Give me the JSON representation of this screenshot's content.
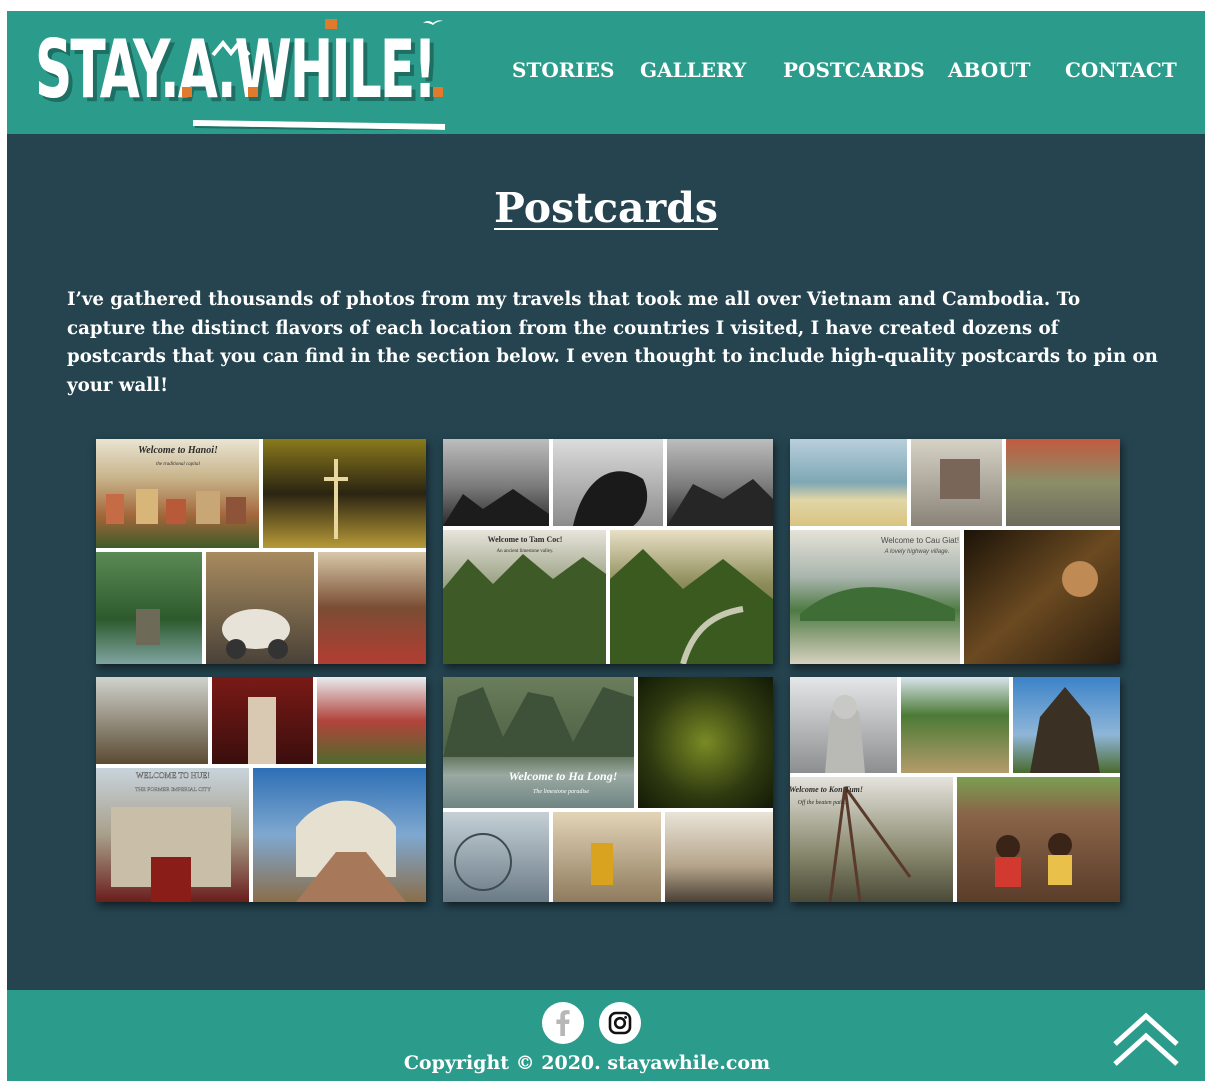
{
  "header": {
    "logo_text": "STAY.A.WHILE!",
    "nav": [
      {
        "label": "STORIES"
      },
      {
        "label": "GALLERY"
      },
      {
        "label": "POSTCARDS"
      },
      {
        "label": "ABOUT"
      },
      {
        "label": "CONTACT"
      }
    ]
  },
  "main": {
    "title": "Postcards",
    "intro": "I’ve gathered thousands of photos from my travels that took me all over Vietnam and Cambodia. To capture the distinct flavors of each location from the countries I visited, I have created dozens of postcards that you can find in the section below. I even thought to include high-quality postcards to pin on your wall!",
    "postcards": [
      {
        "caption_title": "Welcome to Hanoi!",
        "caption_sub": "the traditional capital"
      },
      {
        "caption_title": "Welcome to Tam Coc!",
        "caption_sub": "An ancient limestone valley."
      },
      {
        "caption_title": "Welcome to Cau Giat!",
        "caption_sub": "A lovely highway village."
      },
      {
        "caption_title": "WELCOME TO HUE!",
        "caption_sub": "THE FORMER IMPERIAL CITY"
      },
      {
        "caption_title": "Welcome to Ha Long!",
        "caption_sub": "The limestone paradise"
      },
      {
        "caption_title": "Welcome to Kon Tum!",
        "caption_sub": "Off the beaten path..."
      }
    ]
  },
  "footer": {
    "copyright": "Copyright © 2020. stayawhile.com",
    "facebook_icon": "facebook-icon",
    "instagram_icon": "instagram-icon",
    "back_to_top_icon": "double-chevron-up-icon"
  },
  "colors": {
    "header_bg": "#2b9c8b",
    "page_bg": "#25444f",
    "logo_accent": "#e07b2e"
  }
}
